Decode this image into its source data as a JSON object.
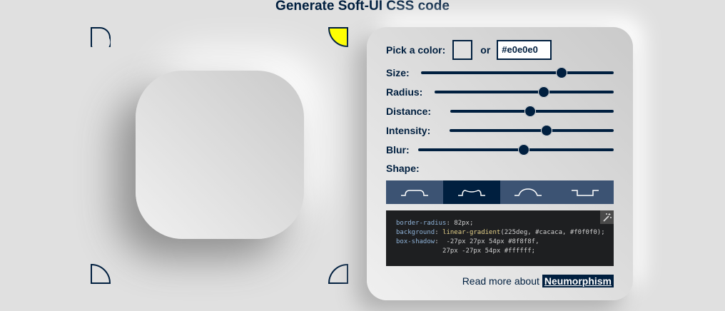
{
  "header": {
    "title_prefix": "Generate ",
    "title_bold": "Soft",
    "title_suffix": "-UI CSS code"
  },
  "colors": {
    "base": "#e0e0e0",
    "accent": "#001f3f",
    "highlight": "#ffff00"
  },
  "light_source_corners": [
    {
      "position": "top-left",
      "active": false
    },
    {
      "position": "top-right",
      "active": true
    },
    {
      "position": "bottom-left",
      "active": false
    },
    {
      "position": "bottom-right",
      "active": false
    }
  ],
  "panel": {
    "color_label": "Pick a color:",
    "or_label": "or",
    "color_value": "#e0e0e0",
    "sliders": [
      {
        "label": "Size:",
        "value_fraction": 0.73
      },
      {
        "label": "Radius:",
        "value_fraction": 0.61
      },
      {
        "label": "Distance:",
        "value_fraction": 0.49
      },
      {
        "label": "Intensity:",
        "value_fraction": 0.59
      },
      {
        "label": "Blur:",
        "value_fraction": 0.54
      }
    ],
    "shape_label": "Shape:",
    "shapes": [
      {
        "name": "flat",
        "active": false
      },
      {
        "name": "concave",
        "active": true
      },
      {
        "name": "convex",
        "active": false
      },
      {
        "name": "pressed",
        "active": false
      }
    ],
    "code": {
      "line1_prop": "border-radius",
      "line1_val": ": 82px;",
      "line2_prop": "background",
      "line2_colon": ": ",
      "line2_fn": "linear-gradient",
      "line2_val": "(225deg, #cacaca, #f0f0f0);",
      "line3_prop": "box-shadow",
      "line3_val": ":  -27px 27px 54px #8f8f8f,",
      "line4_val": "            27px -27px 54px #ffffff;"
    },
    "read_more_text": "Read more about",
    "read_more_link": "Neumorphism"
  }
}
